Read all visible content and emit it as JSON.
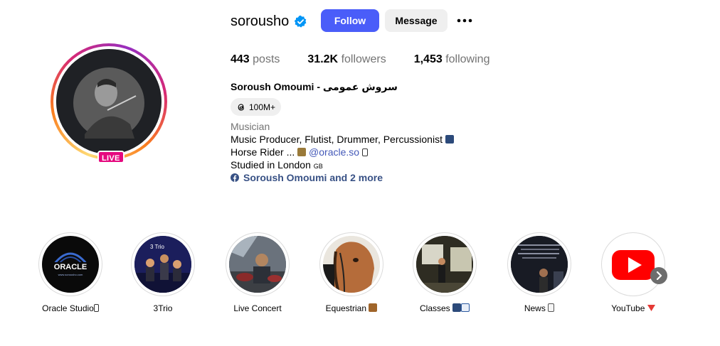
{
  "profile": {
    "username": "sorousho",
    "follow_label": "Follow",
    "message_label": "Message",
    "live_label": "LIVE",
    "stats": {
      "posts_count": "443",
      "posts_label": "posts",
      "followers_count": "31.2K",
      "followers_label": "followers",
      "following_count": "1,453",
      "following_label": "following"
    },
    "full_name": "Soroush Omoumi - سروش عمومی",
    "threads_count": "100M+",
    "category": "Musician",
    "bio": {
      "line1": "Music Producer, Flutist, Drummer, Percussionist",
      "line2_prefix": "Horse Rider ...",
      "line2_link": "@oracle.so",
      "line3": "Studied in London",
      "line3_flag": "GB"
    },
    "facebook_link": "Soroush Omoumi and 2 more"
  },
  "highlights": [
    {
      "label": "Oracle Studio",
      "icon": "oracle-logo"
    },
    {
      "label": "3Trio",
      "icon": "band-photo"
    },
    {
      "label": "Live Concert",
      "icon": "concert-photo"
    },
    {
      "label": "Equestrian",
      "icon": "horse-photo"
    },
    {
      "label": "Classes",
      "icon": "classroom-photo"
    },
    {
      "label": "News",
      "icon": "news-photo"
    },
    {
      "label": "YouTube",
      "icon": "youtube-logo"
    }
  ],
  "colors": {
    "follow_button": "#4a5df9",
    "message_button": "#efefef",
    "live_badge": "#e5097f",
    "link": "#4358b8",
    "verified": "#0095f6",
    "youtube": "#ff0000"
  }
}
